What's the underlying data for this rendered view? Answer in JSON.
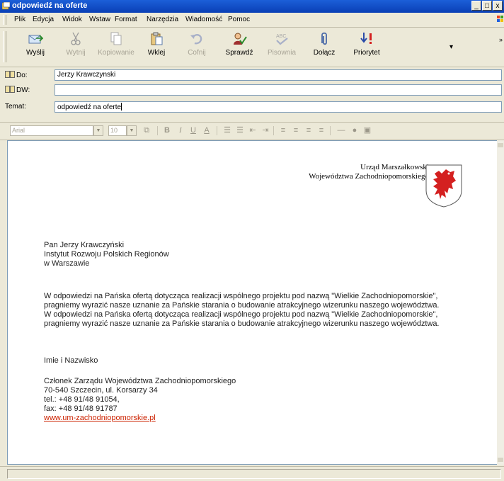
{
  "window": {
    "title": "odpowiedź na oferte"
  },
  "menu": [
    "Plik",
    "Edycja",
    "Widok",
    "Wstaw",
    "Format",
    "Narzędzia",
    "Wiadomość",
    "Pomoc"
  ],
  "toolbar": {
    "buttons": [
      {
        "label": "Wyślij",
        "icon": "send-icon"
      },
      {
        "label": "Wytnij",
        "icon": "cut-icon"
      },
      {
        "label": "Kopiowanie",
        "icon": "copy-icon"
      },
      {
        "label": "Wklej",
        "icon": "paste-icon"
      },
      {
        "label": "Cofnij",
        "icon": "undo-icon"
      },
      {
        "label": "Sprawdź",
        "icon": "check-names-icon"
      },
      {
        "label": "Pisownia",
        "icon": "spelling-icon"
      },
      {
        "label": "Dołącz",
        "icon": "attach-icon"
      },
      {
        "label": "Priorytet",
        "icon": "priority-icon"
      }
    ]
  },
  "headers": {
    "to": {
      "label": "Do:",
      "value": "Jerzy Krawczynski"
    },
    "cc": {
      "label": "DW:",
      "value": ""
    },
    "subject": {
      "label": "Temat:",
      "value": "odpowiedź na oferte"
    }
  },
  "format": {
    "font": "Arial",
    "size": "10"
  },
  "letter": {
    "org_line1": "Urząd Marszałkowski",
    "org_line2": "Województwa Zachodniopomorskiego",
    "addressee": [
      "Pan Jerzy Krawczyński",
      "Instytut Rozwoju Polskich Regionów",
      "w Warszawie"
    ],
    "paragraph": [
      "W odpowiedzi na Pańska ofertą dotycząca realizacji wspólnego projektu pod nazwą \"Wielkie Zachodniopomorskie\",",
      "pragniemy wyrazić nasze uznanie za Pańskie starania o budowanie atrakcyjnego wizerunku naszego województwa.",
      "W odpowiedzi na Pańska ofertą dotycząca realizacji wspólnego projektu pod nazwą \"Wielkie Zachodniopomorskie\",",
      "pragniemy wyrazić nasze uznanie za Pańskie starania o budowanie atrakcyjnego wizerunku naszego województwa."
    ],
    "signature_name": "Imie i Nazwisko",
    "signature": [
      "Członek Zarządu Województwa Zachodniopomorskiego",
      "70-540 Szczecin, ul. Korsarzy 34",
      "tel.: +48 91/48 91054,",
      "fax: +48 91/48 91787"
    ],
    "website": "www.um-zachodniopomorskie.pl"
  },
  "colors": {
    "titlebar": "#0a3fb5",
    "link": "#cc2200",
    "crest_red": "#d42020"
  }
}
